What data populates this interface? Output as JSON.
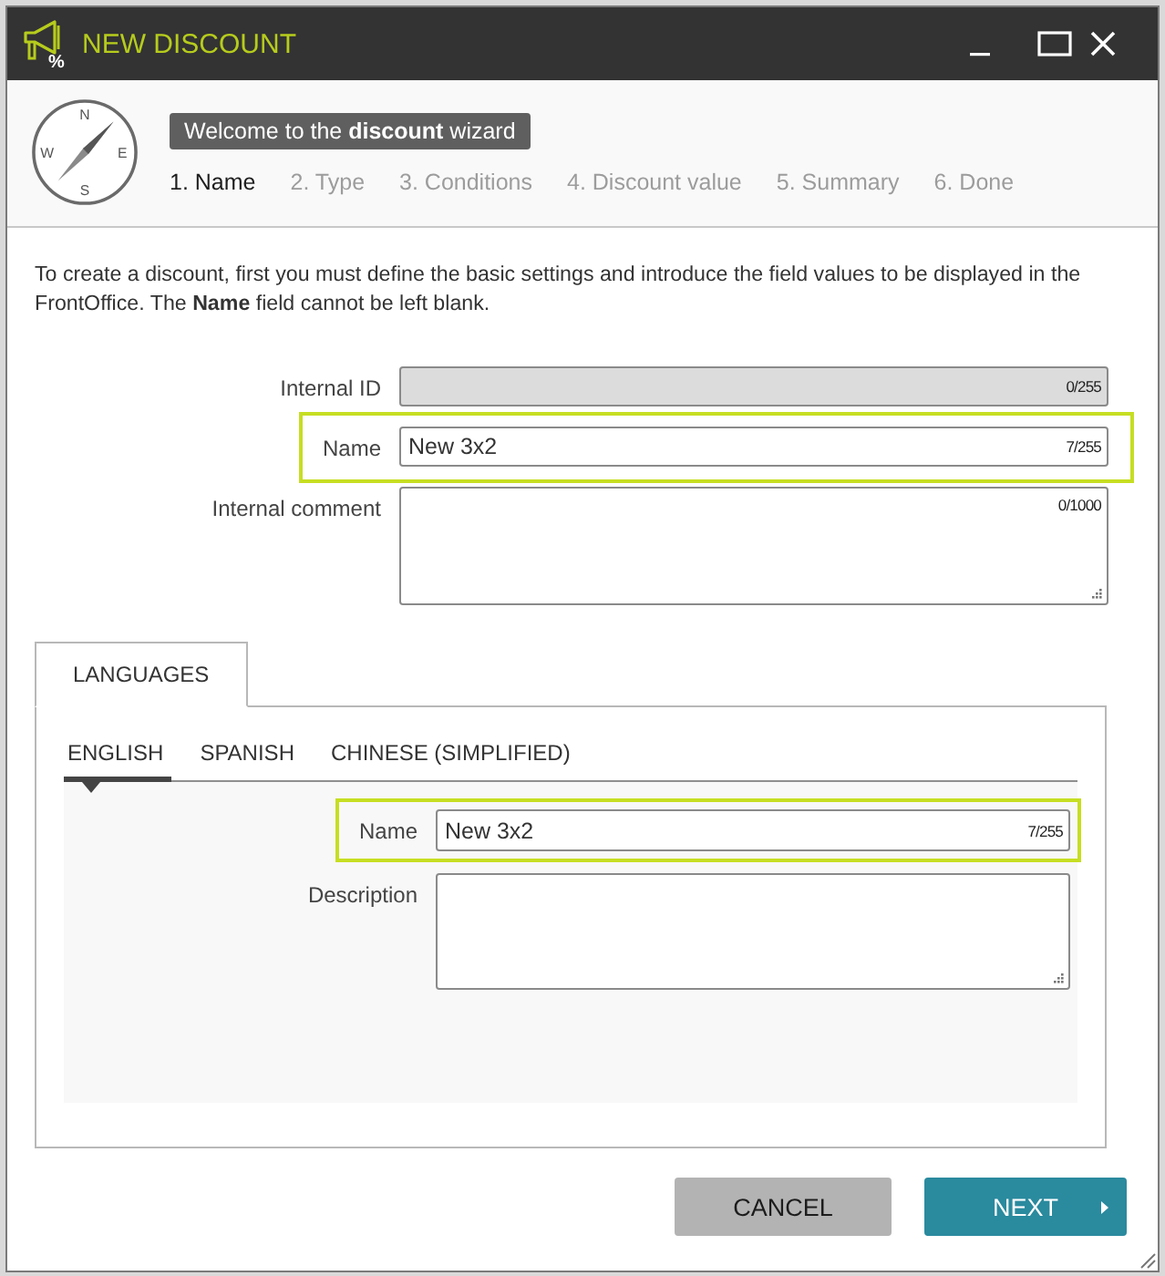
{
  "window": {
    "title": "NEW DISCOUNT",
    "icon_symbol": "%"
  },
  "wizard": {
    "compass_letters": [
      "N",
      "E",
      "S",
      "W"
    ],
    "banner": "Welcome to the **discount** wizard",
    "steps": [
      {
        "label": "1. Name",
        "selected": true
      },
      {
        "label": "2. Type",
        "selected": false
      },
      {
        "label": "3. Conditions",
        "selected": false
      },
      {
        "label": "4. Discount value",
        "selected": false
      },
      {
        "label": "5. Summary",
        "selected": false
      },
      {
        "label": "6. Done",
        "selected": false
      }
    ]
  },
  "intro": "To create a discount, first you must define the basic settings and introduce the field values to be displayed in the FrontOffice. The **Name** field cannot be left blank.",
  "fields": [
    {
      "label": "Internal ID",
      "kind": "input",
      "counter": "0/255",
      "disabled": true,
      "highlighted": false
    },
    {
      "label": "Name",
      "kind": "input",
      "value": "New 3x2",
      "counter": "7/255",
      "disabled": false,
      "highlighted": true
    },
    {
      "label": "Internal comment",
      "kind": "textarea",
      "counter": "0/1000",
      "disabled": false,
      "highlighted": false
    }
  ],
  "languages": {
    "tabs": [
      {
        "label": "LANGUAGES",
        "selected": true
      }
    ],
    "language_tabs": [
      {
        "label": "ENGLISH",
        "selected": true
      },
      {
        "label": "SPANISH",
        "selected": false
      },
      {
        "label": "CHINESE (SIMPLIFIED)",
        "selected": false
      }
    ],
    "fields": [
      {
        "label": "Name",
        "kind": "input",
        "value": "New 3x2",
        "counter": "7/255",
        "highlighted": true
      },
      {
        "label": "Description",
        "kind": "textarea",
        "highlighted": false
      }
    ]
  },
  "buttons": [
    {
      "label": "CANCEL",
      "kind": "cancel"
    },
    {
      "label": "NEXT",
      "kind": "next"
    }
  ]
}
